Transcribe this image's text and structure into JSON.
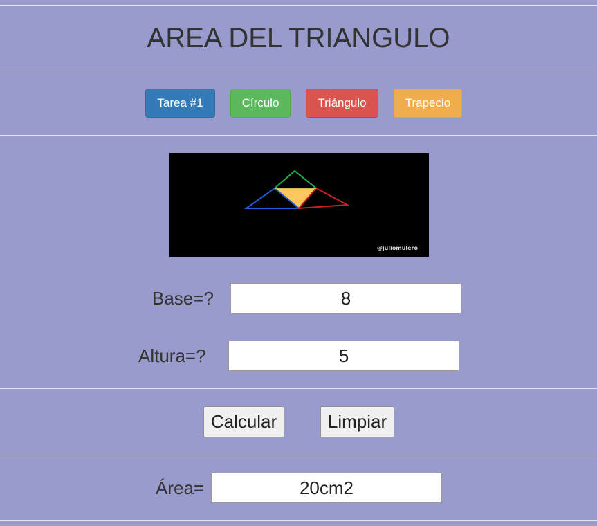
{
  "header": {
    "title": "AREA DEL TRIANGULO"
  },
  "nav": {
    "buttons": [
      {
        "label": "Tarea #1",
        "color": "#337ab7"
      },
      {
        "label": "Círculo",
        "color": "#5cb85c"
      },
      {
        "label": "Triángulo",
        "color": "#d9534f"
      },
      {
        "label": "Trapecio",
        "color": "#f0ad4e"
      }
    ]
  },
  "figure": {
    "watermark": "@juliomulero",
    "colors": {
      "background": "#000000",
      "top_triangle": "#22b14c",
      "left_triangle": "#1f5fd6",
      "right_triangle": "#d01f1f",
      "center_fill": "#fdc65e"
    }
  },
  "form": {
    "base_label": "Base=?",
    "base_value": "8",
    "height_label": "Altura=?",
    "height_value": "5"
  },
  "actions": {
    "calculate_label": "Calcular",
    "clear_label": "Limpiar"
  },
  "result": {
    "area_label": "Área=",
    "area_value": "20cm2"
  },
  "theme": {
    "page_background": "#9a9bcd",
    "divider": "#e6e6f2"
  }
}
